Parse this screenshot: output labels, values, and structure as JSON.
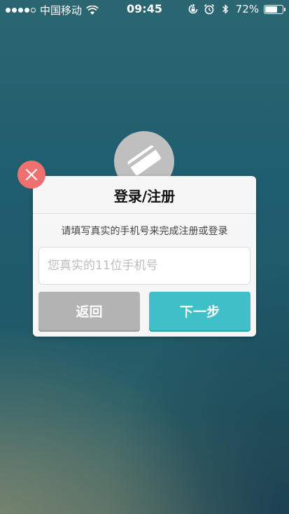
{
  "status_bar": {
    "carrier": "中国移动",
    "time": "09:45",
    "battery_percent": "72%",
    "battery_level": 0.72,
    "signal_bars_filled": 4,
    "icons": [
      "wifi-icon",
      "orientation-lock-icon",
      "alarm-icon",
      "bluetooth-icon",
      "battery-icon"
    ]
  },
  "app_logo": {
    "icon": "app-logo-icon"
  },
  "dialog": {
    "title": "登录/注册",
    "description": "请填写真实的手机号来完成注册或登录",
    "phone_input": {
      "placeholder": "您真实的11位手机号",
      "value": ""
    },
    "back_label": "返回",
    "next_label": "下一步",
    "close_icon": "close-icon"
  },
  "colors": {
    "next_button": "#3fbfc8",
    "back_button": "#b3b3b3",
    "close_button": "#f07070",
    "dialog_bg": "#f6f6f6"
  }
}
